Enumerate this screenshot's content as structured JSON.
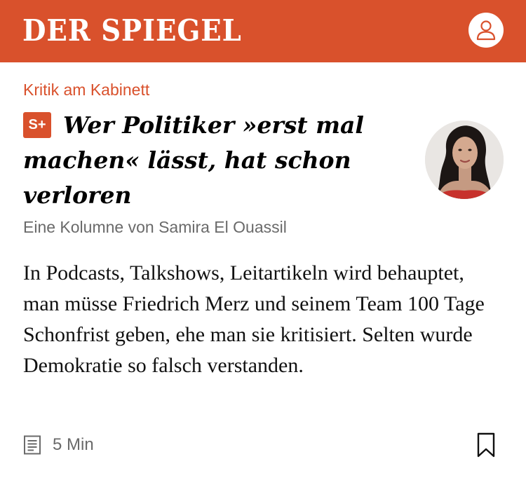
{
  "header": {
    "logo": "DER SPIEGEL",
    "brand_color": "#d9512c",
    "account_icon": "user-icon"
  },
  "article": {
    "kicker": "Kritik am Kabinett",
    "badge": "S+",
    "headline": "Wer Politiker »erst mal machen« lässt, hat schon verloren",
    "byline": "Eine Kolumne von Samira El Ouassil",
    "teaser": "In Podcasts, Talkshows, Leitartikeln wird behauptet, man müsse Friedrich Merz und seinem Team 100 Tage Schonfrist geben, ehe man sie kritisiert. Selten wurde Demokratie so falsch verstanden.",
    "reading_time": "5 Min",
    "reading_time_icon": "article-icon",
    "bookmark_icon": "bookmark-icon",
    "author_photo": "author-avatar"
  }
}
